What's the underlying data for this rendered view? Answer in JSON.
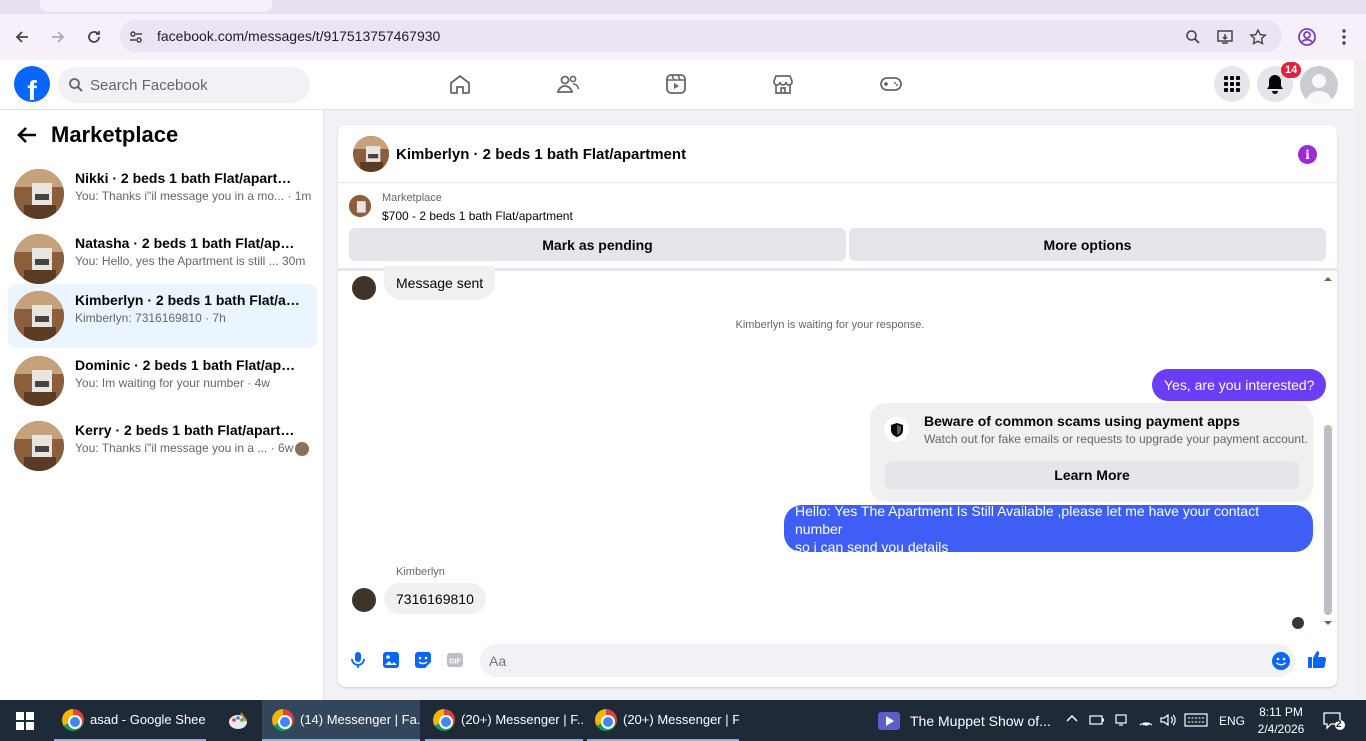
{
  "browser": {
    "url": "facebook.com/messages/t/917513757467930"
  },
  "fb_header": {
    "logo": "f",
    "search_placeholder": "Search Facebook",
    "notification_count": "14"
  },
  "sidebar": {
    "title": "Marketplace",
    "conversations": [
      {
        "name": "Nikki · 2 beds 1 bath Flat/apartment",
        "snippet": "You: Thanks i\"il message you in a mo... · 1m",
        "active": false
      },
      {
        "name": "Natasha · 2 beds 1 bath Flat/apartment",
        "snippet": "You: Hello, yes the Apartment is still ... 30m",
        "active": false
      },
      {
        "name": "Kimberlyn · 2 beds 1 bath Flat/apartment",
        "snippet": "Kimberlyn: 7316169810 · 7h",
        "active": true
      },
      {
        "name": "Dominic · 2 beds 1 bath Flat/apartment",
        "snippet": "You: Im waiting for your number · 4w",
        "active": false
      },
      {
        "name": "Kerry · 2 beds 1 bath Flat/apartment",
        "snippet": "You: Thanks i\"il message you in a ... · 6w",
        "active": false
      }
    ]
  },
  "chat": {
    "title": "Kimberlyn · 2 beds 1 bath Flat/apartment",
    "marketplace_label": "Marketplace",
    "listing": "$700 - 2 beds 1 bath Flat/apartment",
    "mark_pending": "Mark as pending",
    "more_options": "More options",
    "messages": {
      "sent_notice": "Message sent",
      "waiting_note": "Kimberlyn is waiting for your response.",
      "out_1": "Yes, are you interested?",
      "warning_title": "Beware of common scams using payment apps",
      "warning_text": "Watch out for fake emails or requests to upgrade your payment account.",
      "warning_button": "Learn More",
      "out_2_line1": "Hello: Yes The Apartment Is Still Available ,please let me have your contact number",
      "out_2_line2": "so i can send you details",
      "sender": "Kimberlyn",
      "in_number": "7316169810"
    },
    "composer_placeholder": "Aa"
  },
  "taskbar": {
    "items": [
      "asad - Google Shee...",
      "(14) Messenger | Fa...",
      "(20+) Messenger | F...",
      "(20+) Messenger | F..."
    ],
    "media": "The Muppet Show of...",
    "language": "ENG",
    "time": "8:11 PM",
    "date": "2/4/2026",
    "notifications": "2"
  },
  "colors": {
    "fb_blue": "#0866ff",
    "outgoing_bubble": "#6b3df7",
    "info_purple": "#9b2ad8",
    "badge_red": "#e41e3f"
  }
}
